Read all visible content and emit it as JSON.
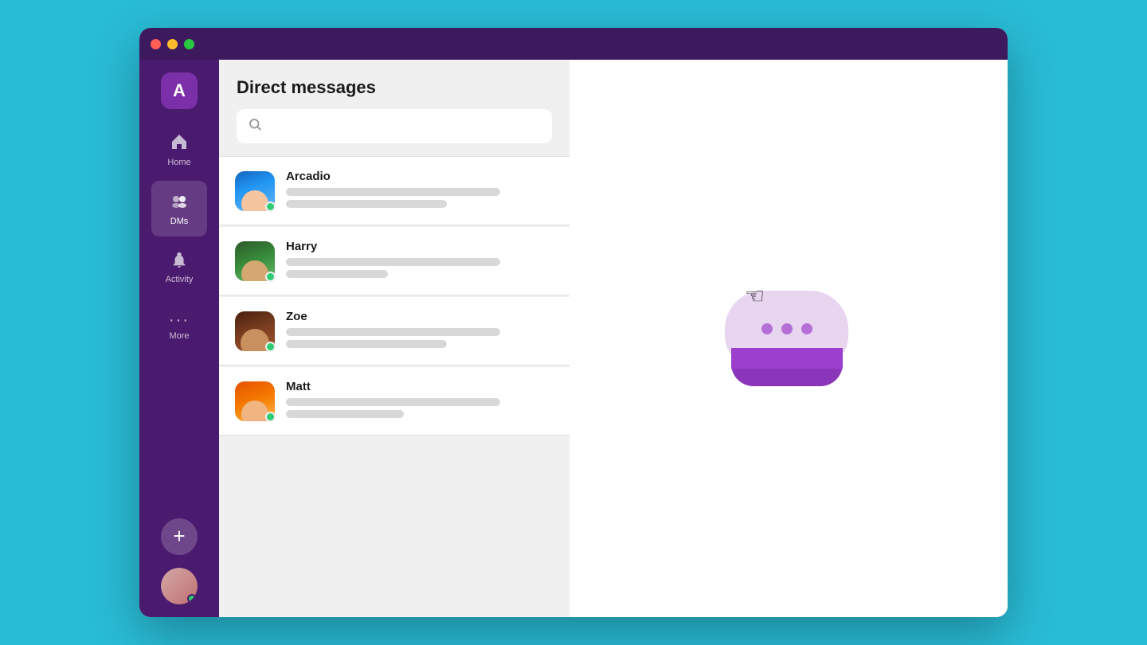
{
  "window": {
    "title": "Direct messages"
  },
  "titlebar": {
    "close_label": "",
    "min_label": "",
    "max_label": ""
  },
  "sidebar": {
    "user_initial": "A",
    "items": [
      {
        "id": "home",
        "label": "Home",
        "icon": "⌂"
      },
      {
        "id": "dms",
        "label": "DMs",
        "icon": "👥",
        "active": true
      },
      {
        "id": "activity",
        "label": "Activity",
        "icon": "🔔"
      },
      {
        "id": "more",
        "label": "More",
        "icon": "···"
      }
    ],
    "add_label": "+",
    "user_avatar_alt": "Current user avatar"
  },
  "dm_panel": {
    "title": "Direct messages",
    "search_placeholder": "",
    "contacts": [
      {
        "id": "arcadio",
        "name": "Arcadio",
        "online": true,
        "preview_long_width": "80%",
        "preview_short_width": "55%"
      },
      {
        "id": "harry",
        "name": "Harry",
        "online": true,
        "preview_long_width": "80%",
        "preview_short_width": "38%"
      },
      {
        "id": "zoe",
        "name": "Zoe",
        "online": true,
        "preview_long_width": "80%",
        "preview_short_width": "60%"
      },
      {
        "id": "matt",
        "name": "Matt",
        "online": true,
        "preview_long_width": "80%",
        "preview_short_width": "44%"
      }
    ]
  },
  "chat_area": {
    "empty_state": true
  }
}
